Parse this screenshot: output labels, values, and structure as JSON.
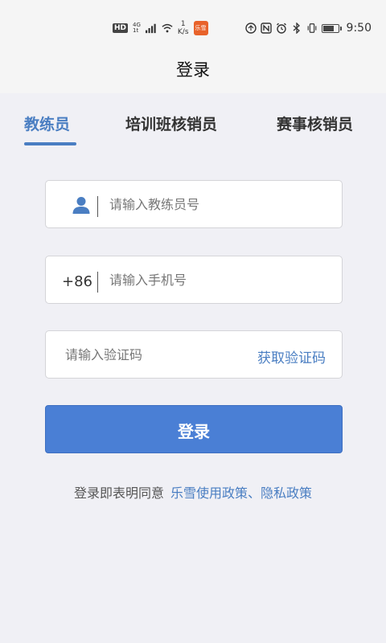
{
  "status_bar": {
    "hd_badge": "HD",
    "net_top": "4G",
    "net_bottom": "1t",
    "speed_value": "1",
    "speed_unit": "K/s",
    "app_badge": "乐雪",
    "time": "9:50",
    "battery_level": 0.8,
    "icons": [
      "wifi-icon",
      "nfc-icon",
      "alarm-icon",
      "bluetooth-icon",
      "vibrate-icon",
      "battery-icon"
    ]
  },
  "header": {
    "title": "登录"
  },
  "tabs": [
    {
      "label": "教练员",
      "active": true
    },
    {
      "label": "培训班核销员",
      "active": false
    },
    {
      "label": "赛事核销员",
      "active": false
    }
  ],
  "form": {
    "coach_id_placeholder": "请输入教练员号",
    "phone_prefix": "+86",
    "phone_placeholder": "请输入手机号",
    "code_placeholder": "请输入验证码",
    "get_code_label": "获取验证码",
    "login_label": "登录"
  },
  "agreement": {
    "text": "登录即表明同意",
    "links": "乐雪使用政策、隐私政策"
  },
  "colors": {
    "accent": "#4a7ec2",
    "button": "#4a7fd5",
    "background": "#f0f0f5"
  }
}
